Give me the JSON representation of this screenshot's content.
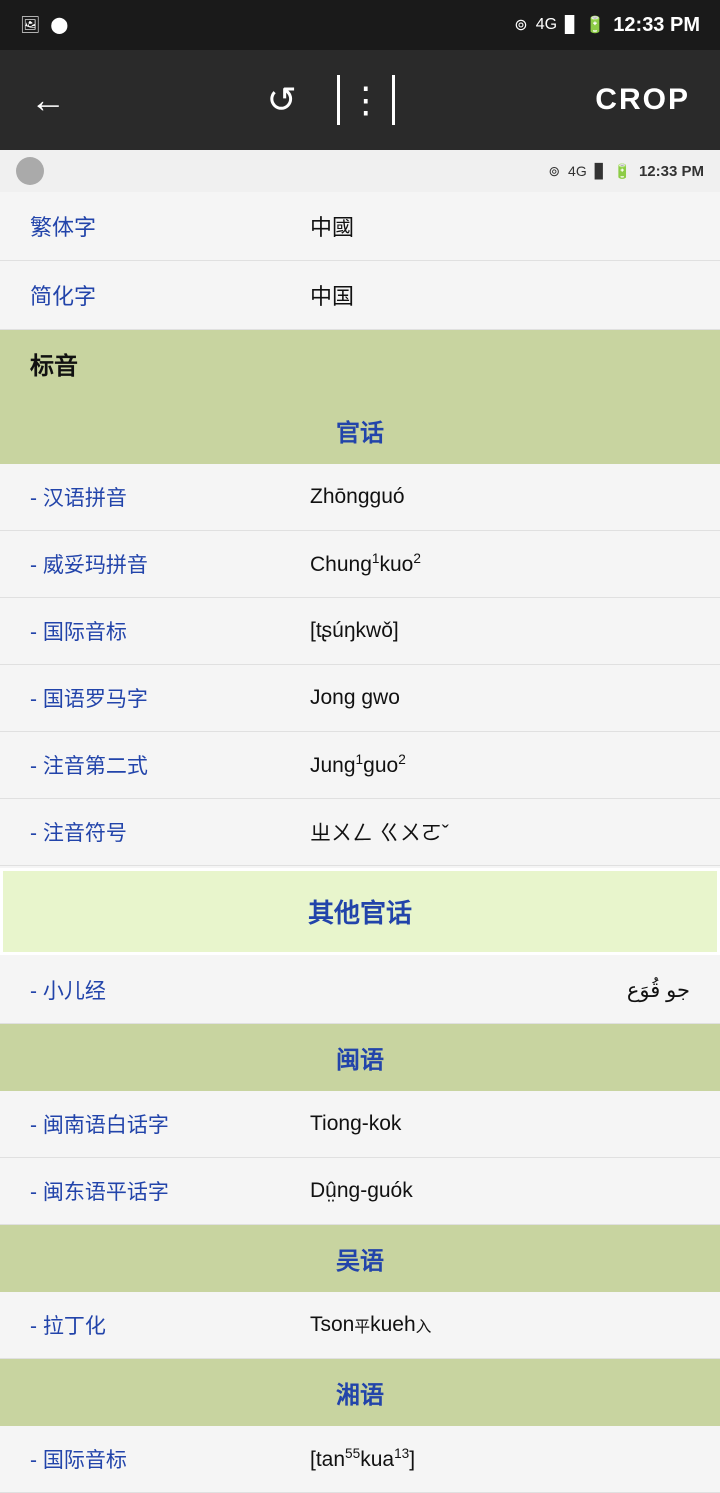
{
  "statusBar": {
    "time": "12:33 PM",
    "icons": [
      "cast",
      "4G",
      "signal",
      "battery"
    ]
  },
  "toolbar": {
    "backLabel": "←",
    "refreshIcon": "↺",
    "compareIcon": "⊟",
    "cropLabel": "CROP"
  },
  "innerStatusBar": {
    "time": "12:33 PM"
  },
  "rows": {
    "traditionalLabel": "繁体字",
    "traditionalValue": "中國",
    "simplifiedLabel": "简化字",
    "simplifiedValue": "中国",
    "phoneticHeader": "标音",
    "mandarinSection": "官话",
    "pinyinLabel": "- 汉语拼音",
    "pinyinValue": "Zhōngguó",
    "wadeLabel": "- 威妥玛拼音",
    "wadeValue": "Chung¹kuo²",
    "ipaLabel": "- 国际音标",
    "ipaValue": "[tʂúŋkwǒ]",
    "guoyinLabel": "- 国语罗马字",
    "guoyinValue": "Jong gwo",
    "zhuyin2Label": "- 注音第二式",
    "zhuyin2Value": "Jung¹guo²",
    "zhuyinLabel": "- 注音符号",
    "zhuyinValue": "ㄓㄨㄥ ㄍㄨㄛˇ",
    "otherMandarinSection": "其他官话",
    "xiaoerjingLabel": "- 小儿经",
    "xiaoerjingValue": "جو قُوَع",
    "minSection": "闽语",
    "minnananLabel": "- 闽南语白话字",
    "minnananValue": "Tiong-kok",
    "mindongLabel": "- 闽东语平话字",
    "mindongValue": "Dṳ̂ng-guók",
    "wuSection": "吴语",
    "latinLabel": "- 拉丁化",
    "latinValue": "Tson平kueh入",
    "xiangSection": "湘语",
    "xiangipaLabel": "- 国际音标",
    "xiangipaValue": "[tan⁵⁵kua¹³]"
  }
}
